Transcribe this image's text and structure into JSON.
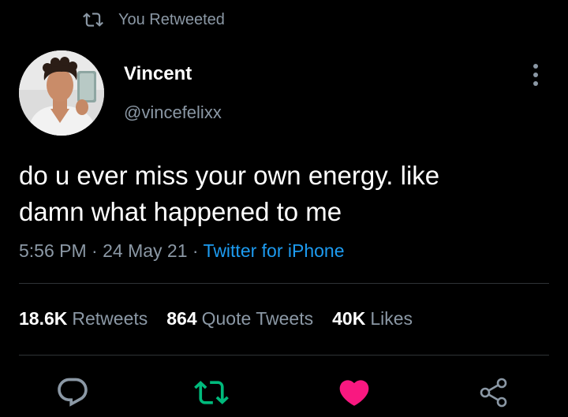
{
  "retweet_context": {
    "label": "You Retweeted",
    "icon": "retweet-icon"
  },
  "author": {
    "name": "Vincent",
    "handle": "@vincefelixx",
    "avatar_icon": "avatar-photo"
  },
  "tweet": {
    "text_line1": "do u ever miss your own energy. like",
    "text_line2": "damn what happened to me"
  },
  "meta": {
    "time": "5:56 PM",
    "sep1": " · ",
    "date": "24 May 21",
    "sep2": " · ",
    "source": "Twitter for iPhone"
  },
  "stats": {
    "retweets_count": "18.6K",
    "retweets_label": "Retweets",
    "quotes_count": "864",
    "quotes_label": "Quote Tweets",
    "likes_count": "40K",
    "likes_label": "Likes"
  },
  "actions": [
    {
      "name": "reply",
      "icon": "reply-icon"
    },
    {
      "name": "retweet",
      "icon": "retweet-icon",
      "active": true
    },
    {
      "name": "like",
      "icon": "heart-icon",
      "active": true
    },
    {
      "name": "share",
      "icon": "share-icon"
    }
  ],
  "colors": {
    "background": "#000000",
    "text_primary": "#e7e9ea",
    "text_secondary": "#8b98a5",
    "link": "#1d9bf0",
    "retweet_active": "#00ba7c",
    "like_active": "#f91880",
    "divider": "#2f3336"
  }
}
